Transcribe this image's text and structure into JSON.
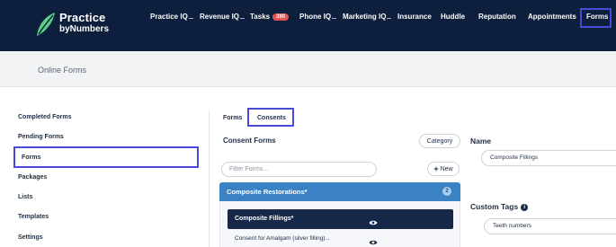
{
  "brand": {
    "line1": "Practice",
    "line2": "byNumbers"
  },
  "nav": {
    "items": [
      {
        "label": "Practice IQ"
      },
      {
        "label": "Revenue IQ"
      },
      {
        "label": "Tasks",
        "badge": "390"
      },
      {
        "label": "Phone IQ"
      },
      {
        "label": "Marketing IQ"
      },
      {
        "label": "Insurance"
      },
      {
        "label": "Huddle"
      },
      {
        "label": "Reputation"
      },
      {
        "label": "Appointments"
      },
      {
        "label": "Forms"
      }
    ]
  },
  "page": {
    "title": "Online Forms"
  },
  "sidebar": {
    "items": [
      {
        "label": "Completed Forms"
      },
      {
        "label": "Pending Forms"
      },
      {
        "label": "Forms"
      },
      {
        "label": "Packages"
      },
      {
        "label": "Lists"
      },
      {
        "label": "Templates"
      },
      {
        "label": "Settings"
      }
    ]
  },
  "tabs": [
    {
      "label": "Forms"
    },
    {
      "label": "Consents"
    }
  ],
  "consent_forms": {
    "title": "Consent Forms",
    "category_button": "Category",
    "new_button": "New",
    "filter_placeholder": "Filter Forms...",
    "category": {
      "name": "Composite Restorations*",
      "count": "2",
      "forms": [
        {
          "label": "Composite Fillings*",
          "active": true
        },
        {
          "label": "Consent for Amalgam (silver filling)...",
          "active": false
        }
      ]
    }
  },
  "detail": {
    "name_label": "Name",
    "name_value": "Composite Fillings",
    "tags_label": "Custom Tags",
    "tag_value": "Teeth numbers"
  },
  "colors": {
    "nav_bg": "#0d1f3c",
    "accent_blue": "#3b82c4",
    "highlight": "#4a4ad9",
    "badge": "#e0534f"
  }
}
